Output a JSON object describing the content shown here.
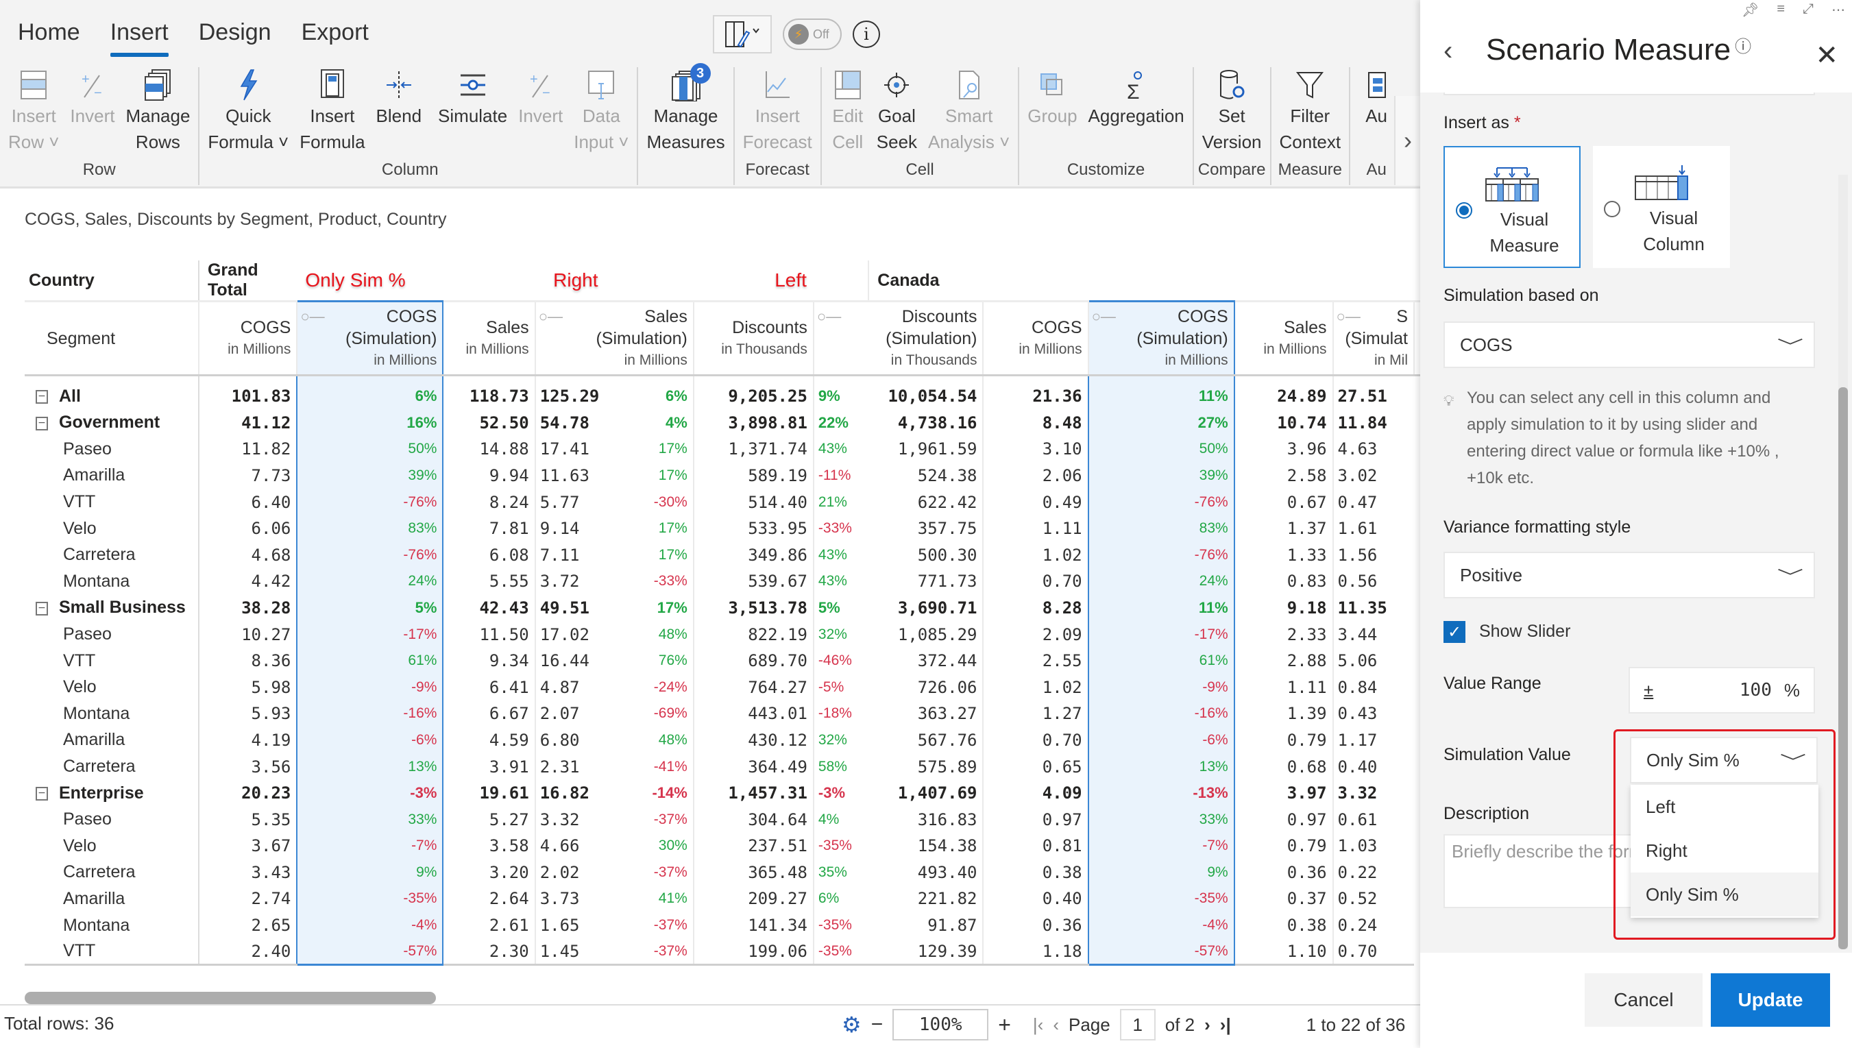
{
  "tabs": [
    {
      "label": "Home",
      "active": false
    },
    {
      "label": "Insert",
      "active": true
    },
    {
      "label": "Design",
      "active": false
    },
    {
      "label": "Export",
      "active": false
    }
  ],
  "top_tools": {
    "toggle_label": "Off",
    "info": "i"
  },
  "ribbon": {
    "groups": [
      {
        "label": "Row",
        "buttons": [
          {
            "line1": "Insert",
            "line2": "Row ˅",
            "disabled": true,
            "icon": "insert-row-icon"
          },
          {
            "line1": "Invert",
            "line2": "",
            "disabled": true,
            "icon": "invert-icon"
          },
          {
            "line1": "Manage",
            "line2": "Rows",
            "disabled": false,
            "icon": "manage-rows-icon"
          }
        ]
      },
      {
        "label": "",
        "buttons": [
          {
            "line1": "Quick",
            "line2": "Formula ˅",
            "disabled": false,
            "icon": "lightning-icon"
          },
          {
            "line1": "Insert",
            "line2": "Formula",
            "disabled": false,
            "icon": "calculator-icon"
          },
          {
            "line1": "Blend",
            "line2": "",
            "disabled": false,
            "icon": "blend-icon"
          }
        ]
      },
      {
        "label": "Column",
        "buttons": [
          {
            "line1": "Simulate",
            "line2": "",
            "disabled": false,
            "icon": "simulate-slider-icon"
          },
          {
            "line1": "Invert",
            "line2": "",
            "disabled": true,
            "icon": "invert-icon"
          },
          {
            "line1": "Data",
            "line2": "Input ˅",
            "disabled": true,
            "icon": "data-input-icon"
          }
        ]
      },
      {
        "label": "",
        "buttons": [
          {
            "line1": "Manage",
            "line2": "Measures",
            "disabled": false,
            "icon": "manage-measures-icon",
            "badge": "3"
          }
        ]
      },
      {
        "label": "Forecast",
        "buttons": [
          {
            "line1": "Insert",
            "line2": "Forecast",
            "disabled": true,
            "icon": "forecast-line-icon"
          }
        ]
      },
      {
        "label": "Cell",
        "buttons": [
          {
            "line1": "Edit",
            "line2": "Cell",
            "disabled": true,
            "icon": "edit-cell-icon"
          },
          {
            "line1": "Goal",
            "line2": "Seek",
            "disabled": false,
            "icon": "goal-seek-icon"
          },
          {
            "line1": "Smart",
            "line2": "Analysis ˅",
            "disabled": true,
            "icon": "smart-analysis-icon"
          }
        ]
      },
      {
        "label": "Customize",
        "buttons": [
          {
            "line1": "Group",
            "line2": "",
            "disabled": true,
            "icon": "group-icon"
          },
          {
            "line1": "Aggregation",
            "line2": "",
            "disabled": false,
            "icon": "sigma-gear-icon"
          }
        ]
      },
      {
        "label": "Compare",
        "buttons": [
          {
            "line1": "Set",
            "line2": "Version",
            "disabled": false,
            "icon": "database-gear-icon"
          }
        ]
      },
      {
        "label": "Measure",
        "buttons": [
          {
            "line1": "Filter",
            "line2": "Context",
            "disabled": false,
            "icon": "filter-icon"
          }
        ]
      },
      {
        "label": "Au",
        "buttons": [
          {
            "line1": "Au",
            "line2": "",
            "disabled": false,
            "icon": "audit-icon"
          }
        ]
      }
    ]
  },
  "visual": {
    "title": "COGS, Sales, Discounts by Segment, Product, Country",
    "header_row1": {
      "corner": "Country",
      "grand_total": "Grand Total",
      "canada": "Canada",
      "annotations": {
        "only_sim": "Only Sim %",
        "right": "Right",
        "left": "Left"
      }
    },
    "header_row2": {
      "segment": "Segment",
      "columns": [
        {
          "title": "COGS",
          "sub": "in Millions"
        },
        {
          "title": "COGS",
          "title2": "(Simulation)",
          "sub": "in Millions"
        },
        {
          "title": "Sales",
          "sub": "in Millions"
        },
        {
          "title": "Sales",
          "title2": "(Simulation)",
          "sub": "in Millions"
        },
        {
          "title": "Discounts",
          "sub": "in Thousands"
        },
        {
          "title": "Discounts",
          "title2": "(Simulation)",
          "sub": "in Thousands"
        },
        {
          "title": "COGS",
          "sub": "in Millions"
        },
        {
          "title": "COGS",
          "title2": "(Simulation)",
          "sub": "in Millions"
        },
        {
          "title": "Sales",
          "sub": "in Millions"
        },
        {
          "title": "S",
          "title2": "(Simulat",
          "sub": "in Mil"
        }
      ]
    },
    "rows": [
      {
        "label": "All",
        "level": 0,
        "cogs": "101.83",
        "cogs_sim_pct": "6%",
        "sales": "118.73",
        "sales_sim": "125.29",
        "sales_sim_pct": "6%",
        "disc": "9,205.25",
        "disc_pct": "9%",
        "disc_sim": "10,054.54",
        "ca_cogs": "21.36",
        "ca_cogs_sim_pct": "11%",
        "ca_sales": "24.89",
        "ca_sales_sim": "27.51"
      },
      {
        "label": "Government",
        "level": 0,
        "cogs": "41.12",
        "cogs_sim_pct": "16%",
        "sales": "52.50",
        "sales_sim": "54.78",
        "sales_sim_pct": "4%",
        "disc": "3,898.81",
        "disc_pct": "22%",
        "disc_sim": "4,738.16",
        "ca_cogs": "8.48",
        "ca_cogs_sim_pct": "27%",
        "ca_sales": "10.74",
        "ca_sales_sim": "11.84"
      },
      {
        "label": "Paseo",
        "level": 1,
        "cogs": "11.82",
        "cogs_sim_pct": "50%",
        "sales": "14.88",
        "sales_sim": "17.41",
        "sales_sim_pct": "17%",
        "disc": "1,371.74",
        "disc_pct": "43%",
        "disc_sim": "1,961.59",
        "ca_cogs": "3.10",
        "ca_cogs_sim_pct": "50%",
        "ca_sales": "3.96",
        "ca_sales_sim": "4.63"
      },
      {
        "label": "Amarilla",
        "level": 1,
        "cogs": "7.73",
        "cogs_sim_pct": "39%",
        "sales": "9.94",
        "sales_sim": "11.63",
        "sales_sim_pct": "17%",
        "disc": "589.19",
        "disc_pct": "-11%",
        "disc_sim": "524.38",
        "ca_cogs": "2.06",
        "ca_cogs_sim_pct": "39%",
        "ca_sales": "2.58",
        "ca_sales_sim": "3.02"
      },
      {
        "label": "VTT",
        "level": 1,
        "cogs": "6.40",
        "cogs_sim_pct": "-76%",
        "sales": "8.24",
        "sales_sim": "5.77",
        "sales_sim_pct": "-30%",
        "disc": "514.40",
        "disc_pct": "21%",
        "disc_sim": "622.42",
        "ca_cogs": "0.49",
        "ca_cogs_sim_pct": "-76%",
        "ca_sales": "0.67",
        "ca_sales_sim": "0.47"
      },
      {
        "label": "Velo",
        "level": 1,
        "cogs": "6.06",
        "cogs_sim_pct": "83%",
        "sales": "7.81",
        "sales_sim": "9.14",
        "sales_sim_pct": "17%",
        "disc": "533.95",
        "disc_pct": "-33%",
        "disc_sim": "357.75",
        "ca_cogs": "1.11",
        "ca_cogs_sim_pct": "83%",
        "ca_sales": "1.37",
        "ca_sales_sim": "1.61"
      },
      {
        "label": "Carretera",
        "level": 1,
        "cogs": "4.68",
        "cogs_sim_pct": "-76%",
        "sales": "6.08",
        "sales_sim": "7.11",
        "sales_sim_pct": "17%",
        "disc": "349.86",
        "disc_pct": "43%",
        "disc_sim": "500.30",
        "ca_cogs": "1.02",
        "ca_cogs_sim_pct": "-76%",
        "ca_sales": "1.33",
        "ca_sales_sim": "1.56"
      },
      {
        "label": "Montana",
        "level": 1,
        "cogs": "4.42",
        "cogs_sim_pct": "24%",
        "sales": "5.55",
        "sales_sim": "3.72",
        "sales_sim_pct": "-33%",
        "disc": "539.67",
        "disc_pct": "43%",
        "disc_sim": "771.73",
        "ca_cogs": "0.70",
        "ca_cogs_sim_pct": "24%",
        "ca_sales": "0.83",
        "ca_sales_sim": "0.56"
      },
      {
        "label": "Small Business",
        "level": 0,
        "cogs": "38.28",
        "cogs_sim_pct": "5%",
        "sales": "42.43",
        "sales_sim": "49.51",
        "sales_sim_pct": "17%",
        "disc": "3,513.78",
        "disc_pct": "5%",
        "disc_sim": "3,690.71",
        "ca_cogs": "8.28",
        "ca_cogs_sim_pct": "11%",
        "ca_sales": "9.18",
        "ca_sales_sim": "11.35"
      },
      {
        "label": "Paseo",
        "level": 1,
        "cogs": "10.27",
        "cogs_sim_pct": "-17%",
        "sales": "11.50",
        "sales_sim": "17.02",
        "sales_sim_pct": "48%",
        "disc": "822.19",
        "disc_pct": "32%",
        "disc_sim": "1,085.29",
        "ca_cogs": "2.09",
        "ca_cogs_sim_pct": "-17%",
        "ca_sales": "2.33",
        "ca_sales_sim": "3.44"
      },
      {
        "label": "VTT",
        "level": 1,
        "cogs": "8.36",
        "cogs_sim_pct": "61%",
        "sales": "9.34",
        "sales_sim": "16.44",
        "sales_sim_pct": "76%",
        "disc": "689.70",
        "disc_pct": "-46%",
        "disc_sim": "372.44",
        "ca_cogs": "2.55",
        "ca_cogs_sim_pct": "61%",
        "ca_sales": "2.88",
        "ca_sales_sim": "5.06"
      },
      {
        "label": "Velo",
        "level": 1,
        "cogs": "5.98",
        "cogs_sim_pct": "-9%",
        "sales": "6.41",
        "sales_sim": "4.87",
        "sales_sim_pct": "-24%",
        "disc": "764.27",
        "disc_pct": "-5%",
        "disc_sim": "726.06",
        "ca_cogs": "1.02",
        "ca_cogs_sim_pct": "-9%",
        "ca_sales": "1.11",
        "ca_sales_sim": "0.84"
      },
      {
        "label": "Montana",
        "level": 1,
        "cogs": "5.93",
        "cogs_sim_pct": "-16%",
        "sales": "6.67",
        "sales_sim": "2.07",
        "sales_sim_pct": "-69%",
        "disc": "443.01",
        "disc_pct": "-18%",
        "disc_sim": "363.27",
        "ca_cogs": "1.27",
        "ca_cogs_sim_pct": "-16%",
        "ca_sales": "1.39",
        "ca_sales_sim": "0.43"
      },
      {
        "label": "Amarilla",
        "level": 1,
        "cogs": "4.19",
        "cogs_sim_pct": "-6%",
        "sales": "4.59",
        "sales_sim": "6.80",
        "sales_sim_pct": "48%",
        "disc": "430.12",
        "disc_pct": "32%",
        "disc_sim": "567.76",
        "ca_cogs": "0.70",
        "ca_cogs_sim_pct": "-6%",
        "ca_sales": "0.79",
        "ca_sales_sim": "1.17"
      },
      {
        "label": "Carretera",
        "level": 1,
        "cogs": "3.56",
        "cogs_sim_pct": "13%",
        "sales": "3.91",
        "sales_sim": "2.31",
        "sales_sim_pct": "-41%",
        "disc": "364.49",
        "disc_pct": "58%",
        "disc_sim": "575.89",
        "ca_cogs": "0.65",
        "ca_cogs_sim_pct": "13%",
        "ca_sales": "0.68",
        "ca_sales_sim": "0.40"
      },
      {
        "label": "Enterprise",
        "level": 0,
        "cogs": "20.23",
        "cogs_sim_pct": "-3%",
        "sales": "19.61",
        "sales_sim": "16.82",
        "sales_sim_pct": "-14%",
        "disc": "1,457.31",
        "disc_pct": "-3%",
        "disc_sim": "1,407.69",
        "ca_cogs": "4.09",
        "ca_cogs_sim_pct": "-13%",
        "ca_sales": "3.97",
        "ca_sales_sim": "3.32"
      },
      {
        "label": "Paseo",
        "level": 1,
        "cogs": "5.35",
        "cogs_sim_pct": "33%",
        "sales": "5.27",
        "sales_sim": "3.32",
        "sales_sim_pct": "-37%",
        "disc": "304.64",
        "disc_pct": "4%",
        "disc_sim": "316.83",
        "ca_cogs": "0.97",
        "ca_cogs_sim_pct": "33%",
        "ca_sales": "0.97",
        "ca_sales_sim": "0.61"
      },
      {
        "label": "Velo",
        "level": 1,
        "cogs": "3.67",
        "cogs_sim_pct": "-7%",
        "sales": "3.58",
        "sales_sim": "4.66",
        "sales_sim_pct": "30%",
        "disc": "237.51",
        "disc_pct": "-35%",
        "disc_sim": "154.38",
        "ca_cogs": "0.81",
        "ca_cogs_sim_pct": "-7%",
        "ca_sales": "0.79",
        "ca_sales_sim": "1.03"
      },
      {
        "label": "Carretera",
        "level": 1,
        "cogs": "3.43",
        "cogs_sim_pct": "9%",
        "sales": "3.20",
        "sales_sim": "2.02",
        "sales_sim_pct": "-37%",
        "disc": "365.48",
        "disc_pct": "35%",
        "disc_sim": "493.40",
        "ca_cogs": "0.38",
        "ca_cogs_sim_pct": "9%",
        "ca_sales": "0.36",
        "ca_sales_sim": "0.22"
      },
      {
        "label": "Amarilla",
        "level": 1,
        "cogs": "2.74",
        "cogs_sim_pct": "-35%",
        "sales": "2.64",
        "sales_sim": "3.73",
        "sales_sim_pct": "41%",
        "disc": "209.27",
        "disc_pct": "6%",
        "disc_sim": "221.82",
        "ca_cogs": "0.40",
        "ca_cogs_sim_pct": "-35%",
        "ca_sales": "0.37",
        "ca_sales_sim": "0.52"
      },
      {
        "label": "Montana",
        "level": 1,
        "cogs": "2.65",
        "cogs_sim_pct": "-4%",
        "sales": "2.61",
        "sales_sim": "1.65",
        "sales_sim_pct": "-37%",
        "disc": "141.34",
        "disc_pct": "-35%",
        "disc_sim": "91.87",
        "ca_cogs": "0.36",
        "ca_cogs_sim_pct": "-4%",
        "ca_sales": "0.38",
        "ca_sales_sim": "0.24"
      },
      {
        "label": "VTT",
        "level": 1,
        "cogs": "2.40",
        "cogs_sim_pct": "-57%",
        "sales": "2.30",
        "sales_sim": "1.45",
        "sales_sim_pct": "-37%",
        "disc": "199.06",
        "disc_pct": "-35%",
        "disc_sim": "129.39",
        "ca_cogs": "1.18",
        "ca_cogs_sim_pct": "-57%",
        "ca_sales": "1.10",
        "ca_sales_sim": "0.70"
      }
    ]
  },
  "footer": {
    "total_rows": "Total rows: 36",
    "zoom": "100%",
    "page_label": "Page",
    "page": "1",
    "of_pages": "of 2",
    "range": "1 to 22 of 36"
  },
  "panel": {
    "title": "Scenario Measure",
    "insert_as_label": "Insert as",
    "required_mark": "*",
    "insert_options": [
      {
        "line1": "Visual",
        "line2": "Measure",
        "selected": true
      },
      {
        "line1": "Visual",
        "line2": "Column",
        "selected": false
      }
    ],
    "simulation_based_on_label": "Simulation based on",
    "simulation_based_on_value": "COGS",
    "hint": "You can select any cell in this column and apply simulation to it by using slider and entering direct value or formula like +10% , +10k etc.",
    "variance_label": "Variance formatting style",
    "variance_value": "Positive",
    "show_slider_label": "Show Slider",
    "show_slider_checked": true,
    "value_range_label": "Value Range",
    "value_range_prefix": "±",
    "value_range_value": "100",
    "value_range_unit": "%",
    "simulation_value_label": "Simulation Value",
    "simulation_value_selected": "Only Sim %",
    "simulation_value_options": [
      "Left",
      "Right",
      "Only Sim %"
    ],
    "description_label": "Description",
    "description_placeholder": "Briefly describe the formula",
    "cancel_label": "Cancel",
    "update_label": "Update"
  },
  "colors": {
    "accent": "#0f6cbd",
    "positive": "#22a746",
    "negative": "#d6344d",
    "annotation": "#e8141c",
    "sim_column_bg": "#eaf3fc"
  }
}
